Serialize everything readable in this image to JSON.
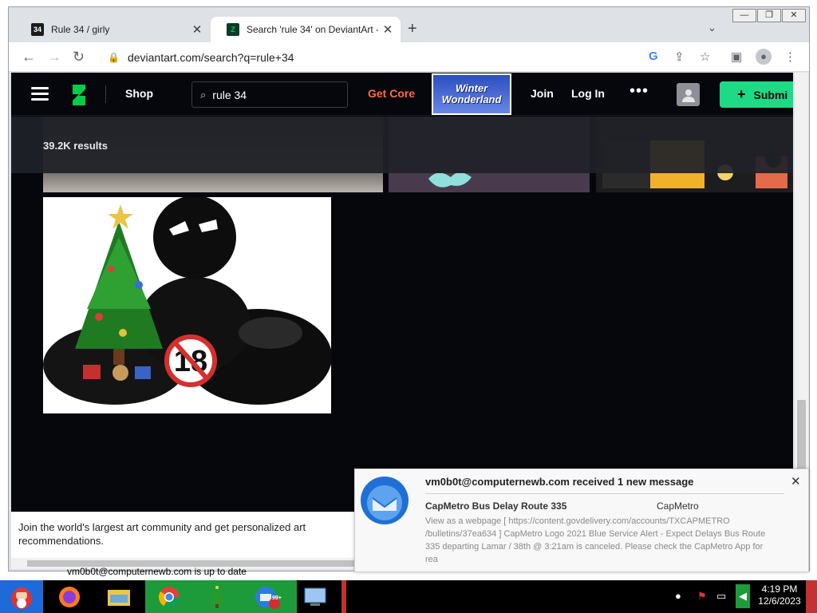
{
  "browser": {
    "tabs": [
      {
        "favicon": "34",
        "title": "Rule 34 / girly",
        "close": "✕"
      },
      {
        "favicon": "DA",
        "title": "Search 'rule 34' on DeviantArt - D",
        "close": "✕"
      }
    ],
    "new_tab": "+",
    "tab_search": "⌄",
    "window_controls": {
      "minimize": "—",
      "restore": "❐",
      "close": "✕"
    },
    "url": "deviantart.com/search?q=rule+34"
  },
  "deviantart": {
    "nav": {
      "shop": "Shop",
      "get_core": "Get Core",
      "join": "Join",
      "login": "Log In",
      "more": "•••"
    },
    "search": {
      "value": "rule 34"
    },
    "promo": {
      "line1": "Winter",
      "line2": "Wonderland"
    },
    "submit_label": "Submi",
    "results_count": "39.2K results",
    "artwork": {
      "badge": "18"
    },
    "join_prompt": "Join the world's largest art community and get personalized art recommendations."
  },
  "status_bar": "vm0b0t@computernewb.com is up to date",
  "notification": {
    "header": "vm0b0t@computernewb.com received 1 new message",
    "subject": "CapMetro Bus Delay Route 335",
    "sender": "CapMetro",
    "body": "View as a webpage [ https://content.govdelivery.com/accounts/TXCAPMETRO /bulletins/37ea634 ] CapMetro Logo 2021 Blue Service Alert - Expect Delays Bus Route 335 departing Lamar / 38th @ 3:21am is canceled. Please check the CapMetro App for rea",
    "close": "✕"
  },
  "taskbar": {
    "clock_time": "4:19 PM",
    "clock_date": "12/6/2023",
    "mail_badge": "99+"
  },
  "colors": {
    "da_green": "#05cc47",
    "submit_green": "#1cdb84",
    "get_core": "#ff6a3d",
    "page_bg": "#06070d"
  }
}
